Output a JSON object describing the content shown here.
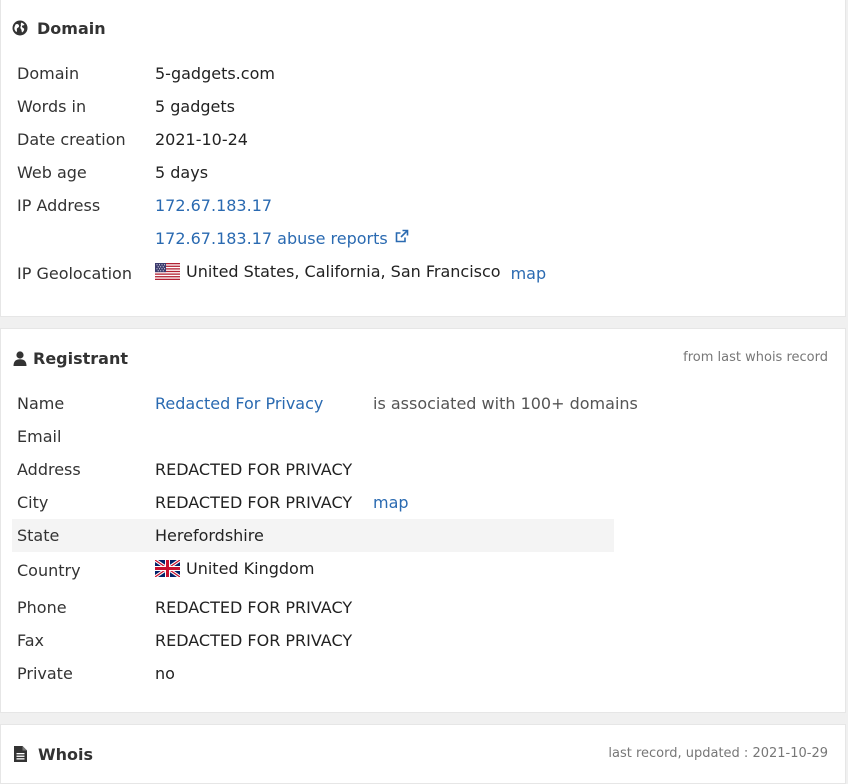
{
  "domain_panel": {
    "title": "Domain",
    "icon": "globe-icon",
    "rows": {
      "domain": {
        "label": "Domain",
        "value": "5-gadgets.com"
      },
      "words": {
        "label": "Words in",
        "value": "5 gadgets"
      },
      "created": {
        "label": "Date creation",
        "value": "2021-10-24"
      },
      "age": {
        "label": "Web age",
        "value": "5 days"
      },
      "ip": {
        "label": "IP Address",
        "value": "172.67.183.17"
      },
      "abuse": {
        "value": "172.67.183.17 abuse reports",
        "icon": "external-link-icon"
      },
      "geo": {
        "label": "IP Geolocation",
        "value": "United States, California, San Francisco",
        "flag": "us-flag-icon",
        "map": "map"
      }
    }
  },
  "registrant_panel": {
    "title": "Registrant",
    "icon": "user-icon",
    "meta": "from last whois record",
    "rows": {
      "name": {
        "label": "Name",
        "value": "Redacted For Privacy",
        "note": "is associated with 100+ domains"
      },
      "email": {
        "label": "Email",
        "value": ""
      },
      "address": {
        "label": "Address",
        "value": "REDACTED FOR PRIVACY"
      },
      "city": {
        "label": "City",
        "value": "REDACTED FOR PRIVACY",
        "map": "map"
      },
      "state": {
        "label": "State",
        "value": "Herefordshire"
      },
      "country": {
        "label": "Country",
        "value": "United Kingdom",
        "flag": "uk-flag-icon"
      },
      "phone": {
        "label": "Phone",
        "value": "REDACTED FOR PRIVACY"
      },
      "fax": {
        "label": "Fax",
        "value": "REDACTED FOR PRIVACY"
      },
      "private": {
        "label": "Private",
        "value": "no"
      }
    }
  },
  "whois_panel": {
    "title": "Whois",
    "icon": "document-icon",
    "meta": "last record, updated : 2021-10-29"
  },
  "colors": {
    "link": "#2a6ab1",
    "highlight_row": "#f4f4f4",
    "text": "#333333",
    "muted": "#777777"
  }
}
